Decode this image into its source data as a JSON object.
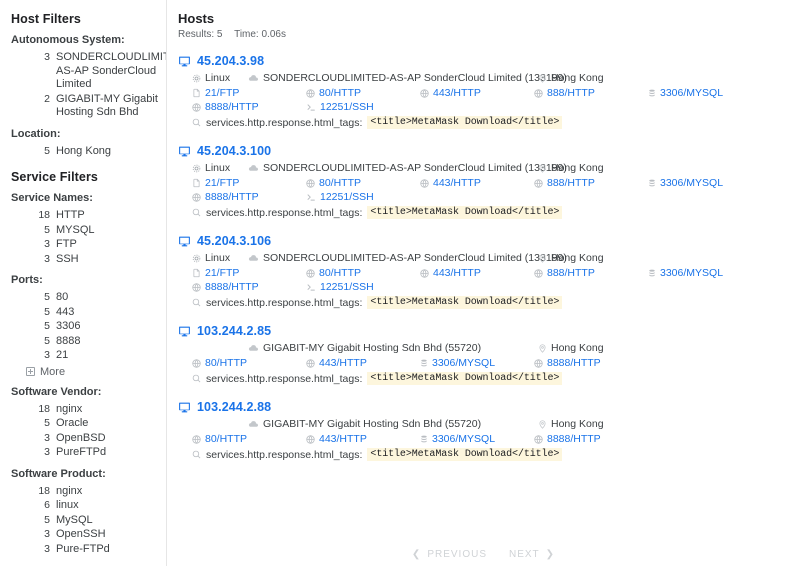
{
  "sidebar": {
    "host_filters_title": "Host Filters",
    "groups": [
      {
        "label": "Autonomous System:",
        "items": [
          {
            "count": "3",
            "label": "SONDERCLOUDLIMITED AS-AP SonderCloud Limited"
          },
          {
            "count": "2",
            "label": "GIGABIT-MY Gigabit Hosting Sdn Bhd"
          }
        ]
      },
      {
        "label": "Location:",
        "items": [
          {
            "count": "5",
            "label": "Hong Kong"
          }
        ]
      }
    ],
    "service_filters_title": "Service Filters",
    "service_groups": [
      {
        "label": "Service Names:",
        "items": [
          {
            "count": "18",
            "label": "HTTP"
          },
          {
            "count": "5",
            "label": "MYSQL"
          },
          {
            "count": "3",
            "label": "FTP"
          },
          {
            "count": "3",
            "label": "SSH"
          }
        ]
      },
      {
        "label": "Ports:",
        "items": [
          {
            "count": "5",
            "label": "80"
          },
          {
            "count": "5",
            "label": "443"
          },
          {
            "count": "5",
            "label": "3306"
          },
          {
            "count": "5",
            "label": "8888"
          },
          {
            "count": "3",
            "label": "21"
          }
        ],
        "more_label": "More"
      },
      {
        "label": "Software Vendor:",
        "items": [
          {
            "count": "18",
            "label": "nginx"
          },
          {
            "count": "5",
            "label": "Oracle"
          },
          {
            "count": "3",
            "label": "OpenBSD"
          },
          {
            "count": "3",
            "label": "PureFTPd"
          }
        ]
      },
      {
        "label": "Software Product:",
        "items": [
          {
            "count": "18",
            "label": "nginx"
          },
          {
            "count": "6",
            "label": "linux"
          },
          {
            "count": "5",
            "label": "MySQL"
          },
          {
            "count": "3",
            "label": "OpenSSH"
          },
          {
            "count": "3",
            "label": "Pure-FTPd"
          }
        ]
      }
    ]
  },
  "main": {
    "title": "Hosts",
    "results_label": "Results: 5",
    "time_label": "Time: 0.06s",
    "hosts": [
      {
        "ip": "45.204.3.98",
        "os": "Linux",
        "autonomous_system": "SONDERCLOUDLIMITED-AS-AP SonderCloud Limited (133199)",
        "location": "Hong Kong",
        "ports": [
          {
            "label": "21/FTP",
            "icon": "file-icon"
          },
          {
            "label": "80/HTTP",
            "icon": "globe-icon"
          },
          {
            "label": "443/HTTP",
            "icon": "globe-icon"
          },
          {
            "label": "888/HTTP",
            "icon": "globe-icon"
          },
          {
            "label": "3306/MYSQL",
            "icon": "database-icon"
          },
          {
            "label": "8888/HTTP",
            "icon": "globe-icon"
          },
          {
            "label": "12251/SSH",
            "icon": "terminal-icon"
          }
        ],
        "match_field": "services.http.response.html_tags:",
        "match_value": "<title>MetaMask Download</title>"
      },
      {
        "ip": "45.204.3.100",
        "os": "Linux",
        "autonomous_system": "SONDERCLOUDLIMITED-AS-AP SonderCloud Limited (133199)",
        "location": "Hong Kong",
        "ports": [
          {
            "label": "21/FTP",
            "icon": "file-icon"
          },
          {
            "label": "80/HTTP",
            "icon": "globe-icon"
          },
          {
            "label": "443/HTTP",
            "icon": "globe-icon"
          },
          {
            "label": "888/HTTP",
            "icon": "globe-icon"
          },
          {
            "label": "3306/MYSQL",
            "icon": "database-icon"
          },
          {
            "label": "8888/HTTP",
            "icon": "globe-icon"
          },
          {
            "label": "12251/SSH",
            "icon": "terminal-icon"
          }
        ],
        "match_field": "services.http.response.html_tags:",
        "match_value": "<title>MetaMask Download</title>"
      },
      {
        "ip": "45.204.3.106",
        "os": "Linux",
        "autonomous_system": "SONDERCLOUDLIMITED-AS-AP SonderCloud Limited (133199)",
        "location": "Hong Kong",
        "ports": [
          {
            "label": "21/FTP",
            "icon": "file-icon"
          },
          {
            "label": "80/HTTP",
            "icon": "globe-icon"
          },
          {
            "label": "443/HTTP",
            "icon": "globe-icon"
          },
          {
            "label": "888/HTTP",
            "icon": "globe-icon"
          },
          {
            "label": "3306/MYSQL",
            "icon": "database-icon"
          },
          {
            "label": "8888/HTTP",
            "icon": "globe-icon"
          },
          {
            "label": "12251/SSH",
            "icon": "terminal-icon"
          }
        ],
        "match_field": "services.http.response.html_tags:",
        "match_value": "<title>MetaMask Download</title>"
      },
      {
        "ip": "103.244.2.85",
        "os": "",
        "autonomous_system": "GIGABIT-MY Gigabit Hosting Sdn Bhd (55720)",
        "location": "Hong Kong",
        "ports": [
          {
            "label": "80/HTTP",
            "icon": "globe-icon"
          },
          {
            "label": "443/HTTP",
            "icon": "globe-icon"
          },
          {
            "label": "3306/MYSQL",
            "icon": "database-icon"
          },
          {
            "label": "8888/HTTP",
            "icon": "globe-icon"
          }
        ],
        "match_field": "services.http.response.html_tags:",
        "match_value": "<title>MetaMask Download</title>"
      },
      {
        "ip": "103.244.2.88",
        "os": "",
        "autonomous_system": "GIGABIT-MY Gigabit Hosting Sdn Bhd (55720)",
        "location": "Hong Kong",
        "ports": [
          {
            "label": "80/HTTP",
            "icon": "globe-icon"
          },
          {
            "label": "443/HTTP",
            "icon": "globe-icon"
          },
          {
            "label": "3306/MYSQL",
            "icon": "database-icon"
          },
          {
            "label": "8888/HTTP",
            "icon": "globe-icon"
          }
        ],
        "match_field": "services.http.response.html_tags:",
        "match_value": "<title>MetaMask Download</title>"
      }
    ]
  },
  "pagination": {
    "previous_label": "PREVIOUS",
    "next_label": "NEXT",
    "prev_chevron": "❮",
    "next_chevron": "❯"
  },
  "colors": {
    "link_blue": "#1a73e8",
    "highlight_yellow": "#fdf6dd",
    "text_primary": "#3c4043",
    "muted": "#9aa0a6"
  }
}
